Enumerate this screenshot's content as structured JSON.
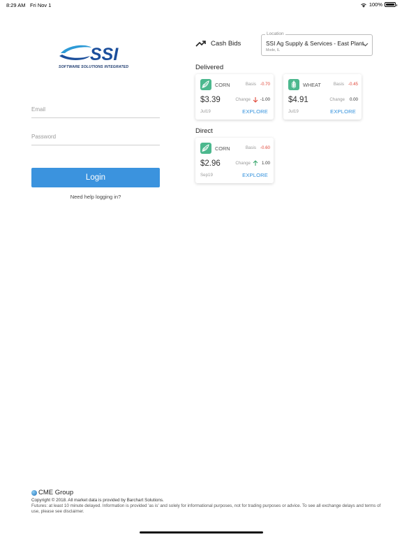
{
  "status_bar": {
    "time": "8:29 AM",
    "date": "Fri Nov 1",
    "battery": "100%",
    "wifi_icon": "wifi-icon",
    "battery_icon": "battery-icon"
  },
  "logo": {
    "text": "SSI",
    "tagline": "SOFTWARE SOLUTIONS INTEGRATED",
    "brand_color": "#1c4f9c",
    "accent_color": "#2d9ad6"
  },
  "login": {
    "email_placeholder": "Email",
    "password_placeholder": "Password",
    "login_label": "Login",
    "help_text": "Need help logging in?",
    "button_color": "#3b93de"
  },
  "cash_bids": {
    "title": "Cash Bids",
    "icon": "trending-up-icon",
    "location": {
      "legend": "Location",
      "name": "SSI Ag Supply & Services - East Plant",
      "city": "Mode, IL"
    },
    "sections": [
      {
        "label": "Delivered",
        "cards": [
          {
            "commodity": "CORN",
            "icon": "corn-icon",
            "basis_label": "Basis",
            "basis": "-0.70",
            "price": "$3.39",
            "change_label": "Change",
            "change_direction": "down",
            "change": "-1.00",
            "month": "Jul19",
            "explore": "EXPLORE"
          },
          {
            "commodity": "WHEAT",
            "icon": "wheat-icon",
            "basis_label": "Basis",
            "basis": "-0.45",
            "price": "$4.91",
            "change_label": "Change",
            "change_direction": "none",
            "change": "0.00",
            "month": "Jul19",
            "explore": "EXPLORE"
          }
        ]
      },
      {
        "label": "Direct",
        "cards": [
          {
            "commodity": "CORN",
            "icon": "corn-icon",
            "basis_label": "Basis",
            "basis": "-0.60",
            "price": "$2.96",
            "change_label": "Change",
            "change_direction": "up",
            "change": "1.00",
            "month": "Sep19",
            "explore": "EXPLORE"
          }
        ]
      }
    ],
    "colors": {
      "negative": "#e0483a",
      "positive": "#3aa76d",
      "link": "#2f8fdc",
      "icon_bg": "#4cb88e"
    }
  },
  "footer": {
    "cme_name": "CME Group",
    "copyright": "Copyright © 2018. All market data is provided by Barchart Solutions.",
    "disclaimer": "Futures: at least 10 minute delayed. Information is provided 'as is' and solely for informational purposes, not for trading purposes or advice. To see all exchange delays and terms of use, please see disclaimer."
  }
}
